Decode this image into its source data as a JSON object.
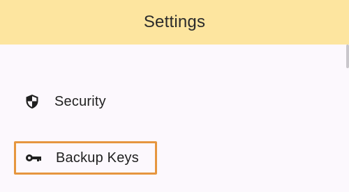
{
  "app_bar": {
    "title": "Settings"
  },
  "settings_list": {
    "items": [
      {
        "label": "Security",
        "icon": "shield-icon"
      },
      {
        "label": "Backup Keys",
        "icon": "key-icon",
        "highlighted": true,
        "highlight_color": "#e6963f"
      }
    ]
  },
  "colors": {
    "app_bar_background": "#fde59f",
    "content_background": "#fcf8fd"
  }
}
